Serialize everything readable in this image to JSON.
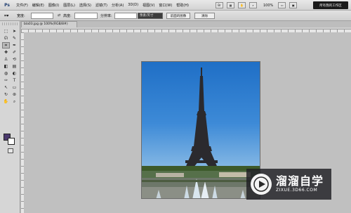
{
  "app": {
    "logo": "Ps"
  },
  "menu": [
    "文件(F)",
    "编辑(E)",
    "图像(I)",
    "图层(L)",
    "选择(S)",
    "滤镜(T)",
    "分析(A)",
    "3D(D)",
    "视图(V)",
    "窗口(W)",
    "帮助(H)"
  ],
  "menubar_tools": {
    "zoom": "100%"
  },
  "workspace_button": "所有我的工作区",
  "options": {
    "tool_icon": "crop-icon",
    "width_label": "宽度:",
    "width_value": "",
    "swap_symbol": "⇄",
    "height_label": "高度:",
    "height_value": "",
    "resolution_label": "分辨率:",
    "resolution_value": "",
    "unit_select": "像素/英寸",
    "front_image_button": "前面的图像",
    "clear_button": "清除"
  },
  "document": {
    "tab_title": "bla03.jpg @ 100%(RGB/8#)"
  },
  "toolbox_tools": [
    "move-icon",
    "marquee-icon",
    "lasso-icon",
    "quick-select-icon",
    "crop-icon",
    "eyedropper-icon",
    "healing-icon",
    "brush-icon",
    "stamp-icon",
    "history-brush-icon",
    "eraser-icon",
    "gradient-icon",
    "blur-icon",
    "dodge-icon",
    "pen-icon",
    "type-icon",
    "path-select-icon",
    "shape-icon",
    "3d-rotate-icon",
    "3d-orbit-icon",
    "hand-icon",
    "zoom-icon"
  ],
  "colors": {
    "foreground": "#4b3a6e",
    "background": "#ffffff"
  },
  "watermark": {
    "title": "溜溜自学",
    "url": "ZIXUE.3D66.COM"
  }
}
